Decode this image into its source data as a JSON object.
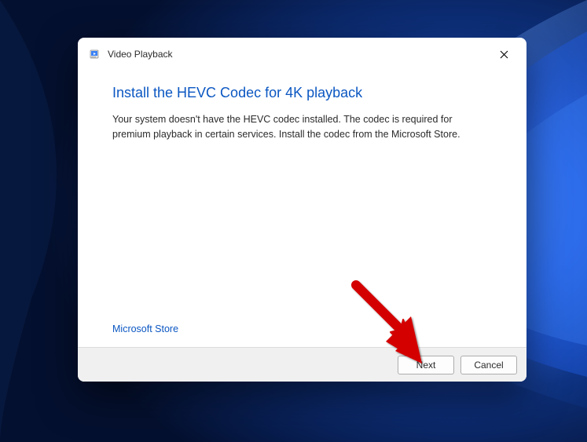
{
  "window": {
    "title": "Video Playback"
  },
  "dialog": {
    "heading": "Install the HEVC Codec for 4K playback",
    "body": "Your system doesn't have the HEVC codec installed. The codec is required for premium playback in certain services. Install the codec from the Microsoft Store.",
    "link_label": "Microsoft Store"
  },
  "buttons": {
    "next": "Next",
    "cancel": "Cancel"
  }
}
